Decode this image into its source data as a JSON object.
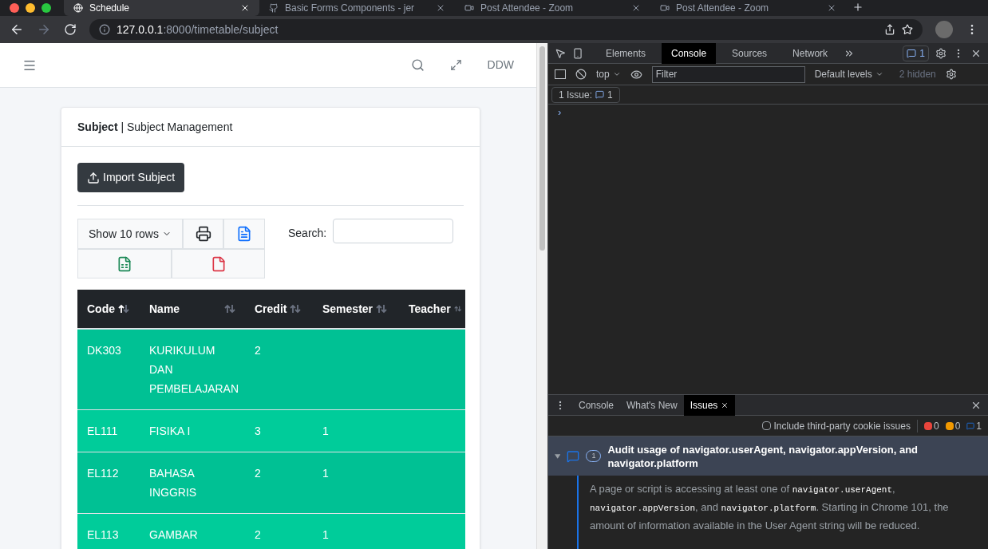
{
  "browser": {
    "tabs": [
      {
        "title": "Schedule",
        "selected": true
      },
      {
        "title": "Basic Forms Components - jer",
        "selected": false
      },
      {
        "title": "Post Attendee - Zoom",
        "selected": false
      },
      {
        "title": "Post Attendee - Zoom",
        "selected": false
      }
    ],
    "url_host": "127.0.0.1",
    "url_rest": ":8000/timetable/subject"
  },
  "page": {
    "user": "DDW",
    "card": {
      "title_bold": "Subject",
      "title_separator": "|",
      "title_rest": "Subject Management",
      "import_button": "Import Subject",
      "length_button": "Show 10 rows",
      "search_label": "Search:",
      "columns": [
        {
          "label": "Code",
          "sorted": true
        },
        {
          "label": "Name",
          "sorted": false
        },
        {
          "label": "Credit",
          "sorted": false
        },
        {
          "label": "Semester",
          "sorted": false
        },
        {
          "label": "Teacher",
          "sorted": false
        }
      ],
      "rows": [
        {
          "code": "DK303",
          "name": [
            "KURIKULUM",
            "DAN",
            "PEMBELAJARAN"
          ],
          "credit": "2"
        },
        {
          "code": "EL111",
          "name": [
            "FISIKA I"
          ],
          "credit": "3",
          "semester": "1"
        },
        {
          "code": "EL112",
          "name": [
            "BAHASA",
            "INGGRIS"
          ],
          "credit": "2",
          "semester": "1"
        },
        {
          "code": "EL113",
          "name": [
            "GAMBAR"
          ],
          "credit": "2",
          "semester": "1"
        }
      ]
    }
  },
  "devtools": {
    "tabs": [
      {
        "label": "Elements",
        "selected": false
      },
      {
        "label": "Console",
        "selected": true
      },
      {
        "label": "Sources",
        "selected": false
      },
      {
        "label": "Network",
        "selected": false
      }
    ],
    "message_count": "1",
    "context": "top",
    "filter_placeholder": "Filter",
    "levels": "Default levels",
    "hidden": "2 hidden",
    "issue_label": "1 Issue:",
    "issue_count": "1",
    "prompt": "›",
    "drawer": {
      "tabs": [
        {
          "label": "Console",
          "selected": false
        },
        {
          "label": "What's New",
          "selected": false
        },
        {
          "label": "Issues",
          "selected": true
        }
      ],
      "cookie_checkbox": {
        "label": "Include third-party cookie issues",
        "checked": false
      },
      "errors": "0",
      "warnings": "0",
      "infos": "1",
      "issue": {
        "title": "Audit usage of navigator.userAgent, navigator.appVersion, and navigator.platform",
        "count": "1",
        "expanded": true,
        "body": [
          {
            "kind": "text",
            "text": "A page or script is accessing at least one of "
          },
          {
            "kind": "code",
            "text": "navigator.userAgent"
          },
          {
            "kind": "text",
            "text": ", "
          },
          {
            "kind": "code",
            "text": "navigator.appVersion"
          },
          {
            "kind": "text",
            "text": ", and "
          },
          {
            "kind": "code",
            "text": "navigator.platform"
          },
          {
            "kind": "text",
            "text": ". Starting in Chrome 101, the amount of information available in the User Agent string will be reduced."
          }
        ]
      }
    }
  }
}
